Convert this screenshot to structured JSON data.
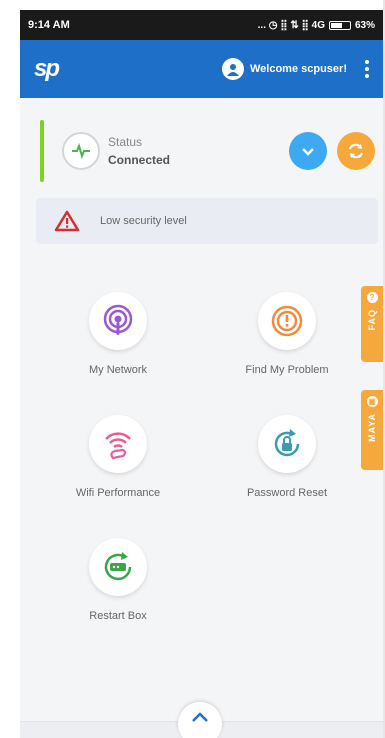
{
  "statusbar": {
    "time": "9:14 AM",
    "signal_text": "... ◷ ⣿ ⇅ ⣿ 4G",
    "battery": "63%",
    "battery_level": 0.63
  },
  "appbar": {
    "logo": "sp",
    "welcome_text": "Welcome scpuser!"
  },
  "connection": {
    "label": "Status",
    "value": "Connected"
  },
  "security_warning": "Low security level",
  "tiles": [
    {
      "label": "My Network",
      "icon": "podcast-icon",
      "color": "#9b59d0"
    },
    {
      "label": "Find My Problem",
      "icon": "search-alert-icon",
      "color": "#f08a3c"
    },
    {
      "label": "Wifi Performance",
      "icon": "wifi-hand-icon",
      "color": "#e95e9a"
    },
    {
      "label": "Password Reset",
      "icon": "lock-reset-icon",
      "color": "#3a9bb3"
    },
    {
      "label": "Restart Box",
      "icon": "router-restart-icon",
      "color": "#3aa54a"
    }
  ],
  "side_tabs": {
    "faq": "FAQ",
    "maya": "MAYA"
  },
  "colors": {
    "primary": "#1e6fc8",
    "accent_orange": "#f4a93a",
    "accent_blue": "#3da9f0",
    "connected_green": "#7ed321",
    "warning_red": "#d0312d"
  }
}
